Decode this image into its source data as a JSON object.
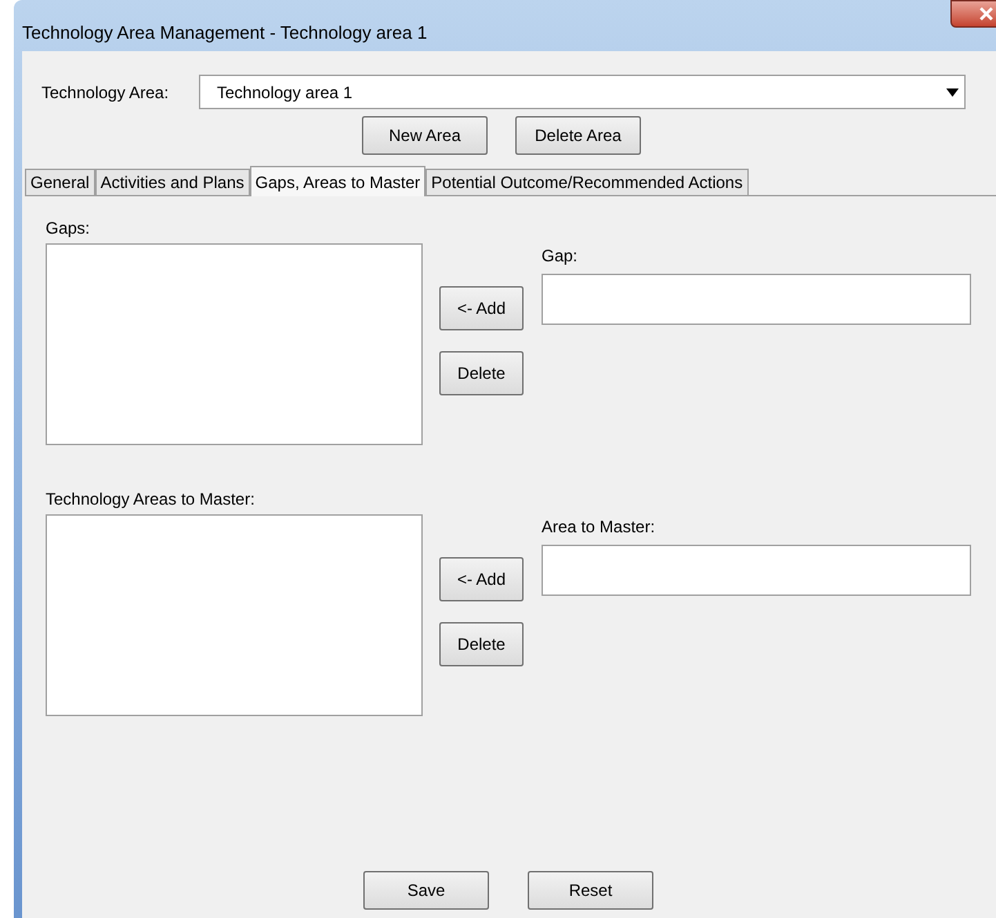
{
  "window": {
    "title": "Technology Area Management - Technology area 1"
  },
  "technology_area": {
    "label": "Technology Area:",
    "value": "Technology area 1"
  },
  "area_buttons": [
    "New Area",
    "Delete Area"
  ],
  "tabs": [
    {
      "label": "General",
      "selected": false
    },
    {
      "label": "Activities and Plans",
      "selected": false
    },
    {
      "label": "Gaps, Areas to Master",
      "selected": true
    },
    {
      "label": "Potential Outcome/Recommended Actions",
      "selected": false
    }
  ],
  "sections": [
    {
      "list_label": "Gaps:",
      "field_label": "Gap:",
      "buttons": [
        "<- Add",
        "Delete"
      ]
    },
    {
      "list_label": "Technology Areas to Master:",
      "field_label": "Area to Master:",
      "buttons": [
        "<- Add",
        "Delete"
      ]
    }
  ],
  "footer_buttons": [
    "Save",
    "Reset"
  ]
}
